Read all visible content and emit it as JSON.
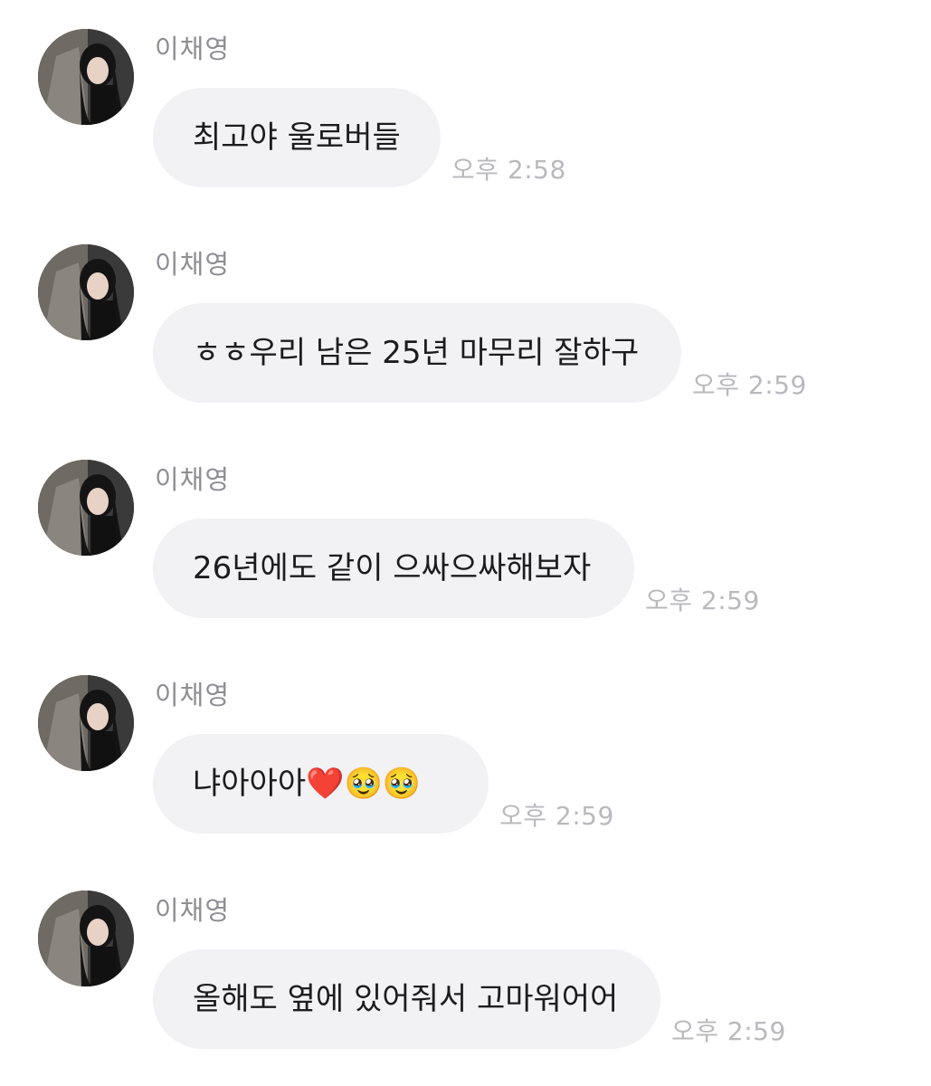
{
  "chat": {
    "messages": [
      {
        "sender": "이채영",
        "text": "최고야 울로버들",
        "time": "오후 2:58"
      },
      {
        "sender": "이채영",
        "text": "ㅎㅎ우리 남은 25년 마무리 잘하구",
        "time": "오후 2:59"
      },
      {
        "sender": "이채영",
        "text": "26년에도 같이 으싸으싸해보자",
        "time": "오후 2:59"
      },
      {
        "sender": "이채영",
        "text": "냐아아아❤️🥹🥹",
        "time": "오후 2:59"
      },
      {
        "sender": "이채영",
        "text": "올해도 옆에 있어줘서 고마워어어",
        "time": "오후 2:59"
      }
    ]
  },
  "colors": {
    "bubble": "#f2f2f5",
    "sender": "#8e8e93",
    "time": "#b9b9be",
    "text": "#1c1c1e"
  },
  "icons": {
    "avatar": "profile-photo-avatar"
  }
}
